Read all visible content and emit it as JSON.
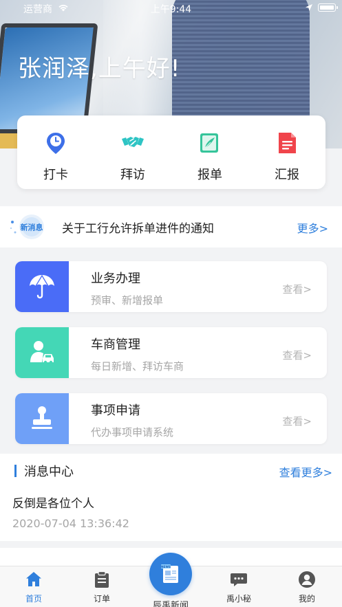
{
  "status_bar": {
    "carrier": "运营商",
    "time": "上午9:44"
  },
  "greeting": "张润泽,上午好!",
  "quick_actions": [
    {
      "label": "打卡",
      "icon": "clock-pin-icon",
      "color": "#3d6fe8"
    },
    {
      "label": "拜访",
      "icon": "handshake-icon",
      "color": "#2ec4c4"
    },
    {
      "label": "报单",
      "icon": "edit-form-icon",
      "color": "#35c49a"
    },
    {
      "label": "汇报",
      "icon": "report-document-icon",
      "color": "#f0444b"
    }
  ],
  "notice": {
    "badge": "新消息",
    "text": "关于工行允许拆单进件的通知",
    "more": "更多>"
  },
  "services": [
    {
      "title": "业务办理",
      "subtitle": "预审、新增报单",
      "view": "查看>",
      "icon": "umbrella-icon",
      "color": "#4a6cf7"
    },
    {
      "title": "车商管理",
      "subtitle": "每日新增、拜访车商",
      "view": "查看>",
      "icon": "person-car-icon",
      "color": "#44d7b6"
    },
    {
      "title": "事项申请",
      "subtitle": "代办事项申请系统",
      "view": "查看>",
      "icon": "stamp-icon",
      "color": "#6fa0f7"
    }
  ],
  "message_center": {
    "title": "消息中心",
    "more": "查看更多>",
    "item_text": "反倒是各位个人",
    "item_time": "2020-07-04 13:36:42"
  },
  "tabbar": [
    {
      "label": "首页",
      "icon": "home-icon",
      "active": true
    },
    {
      "label": "订单",
      "icon": "clipboard-icon",
      "active": false
    },
    {
      "label": "辰禹新闻",
      "icon": "news-icon",
      "active": false
    },
    {
      "label": "禹小秘",
      "icon": "chat-bubble-icon",
      "active": false
    },
    {
      "label": "我的",
      "icon": "user-avatar-icon",
      "active": false
    }
  ],
  "colors": {
    "accent": "#2f7fdc"
  }
}
